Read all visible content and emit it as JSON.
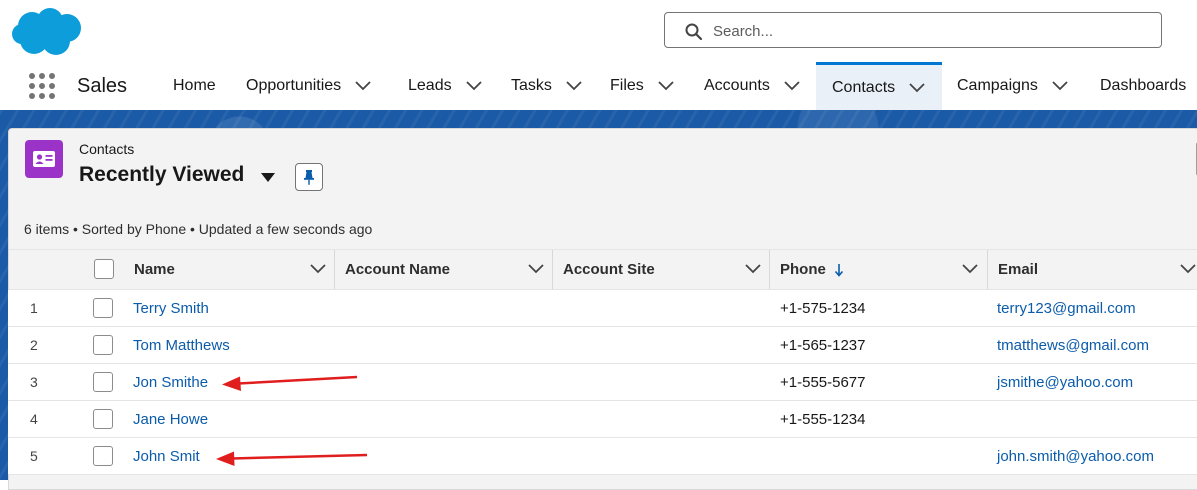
{
  "header": {
    "search": {
      "placeholder": "Search..."
    }
  },
  "nav": {
    "app_name": "Sales",
    "tabs": [
      {
        "label": "Home",
        "has_menu": false,
        "active": false
      },
      {
        "label": "Opportunities",
        "has_menu": true,
        "active": false
      },
      {
        "label": "Leads",
        "has_menu": true,
        "active": false
      },
      {
        "label": "Tasks",
        "has_menu": true,
        "active": false
      },
      {
        "label": "Files",
        "has_menu": true,
        "active": false
      },
      {
        "label": "Accounts",
        "has_menu": true,
        "active": false
      },
      {
        "label": "Contacts",
        "has_menu": true,
        "active": true
      },
      {
        "label": "Campaigns",
        "has_menu": true,
        "active": false
      },
      {
        "label": "Dashboards",
        "has_menu": false,
        "active": false
      }
    ]
  },
  "list_view": {
    "object_label": "Contacts",
    "title": "Recently Viewed",
    "meta": "6 items • Sorted by Phone • Updated a few seconds ago",
    "columns": [
      {
        "label": "Name"
      },
      {
        "label": "Account Name"
      },
      {
        "label": "Account Site"
      },
      {
        "label": "Phone",
        "sort_icon": "arrow-down-icon"
      },
      {
        "label": "Email"
      }
    ],
    "rows": [
      {
        "num": "1",
        "name": "Terry Smith",
        "account_name": "",
        "account_site": "",
        "phone": "+1-575-1234",
        "email": "terry123@gmail.com"
      },
      {
        "num": "2",
        "name": "Tom Matthews",
        "account_name": "",
        "account_site": "",
        "phone": "+1-565-1237",
        "email": "tmatthews@gmail.com"
      },
      {
        "num": "3",
        "name": "Jon Smithe",
        "account_name": "",
        "account_site": "",
        "phone": "+1-555-5677",
        "email": "jsmithe@yahoo.com"
      },
      {
        "num": "4",
        "name": "Jane Howe",
        "account_name": "",
        "account_site": "",
        "phone": "+1-555-1234",
        "email": ""
      },
      {
        "num": "5",
        "name": "John Smit",
        "account_name": "",
        "account_site": "",
        "phone": "",
        "email": "john.smith@yahoo.com"
      }
    ]
  },
  "annotations": {
    "arrow_color": "#e01e1e"
  },
  "colors": {
    "brand": "#0176d3",
    "link": "#0b5cab",
    "contact_icon_bg": "#9b33c8",
    "logo": "#1798c1"
  }
}
